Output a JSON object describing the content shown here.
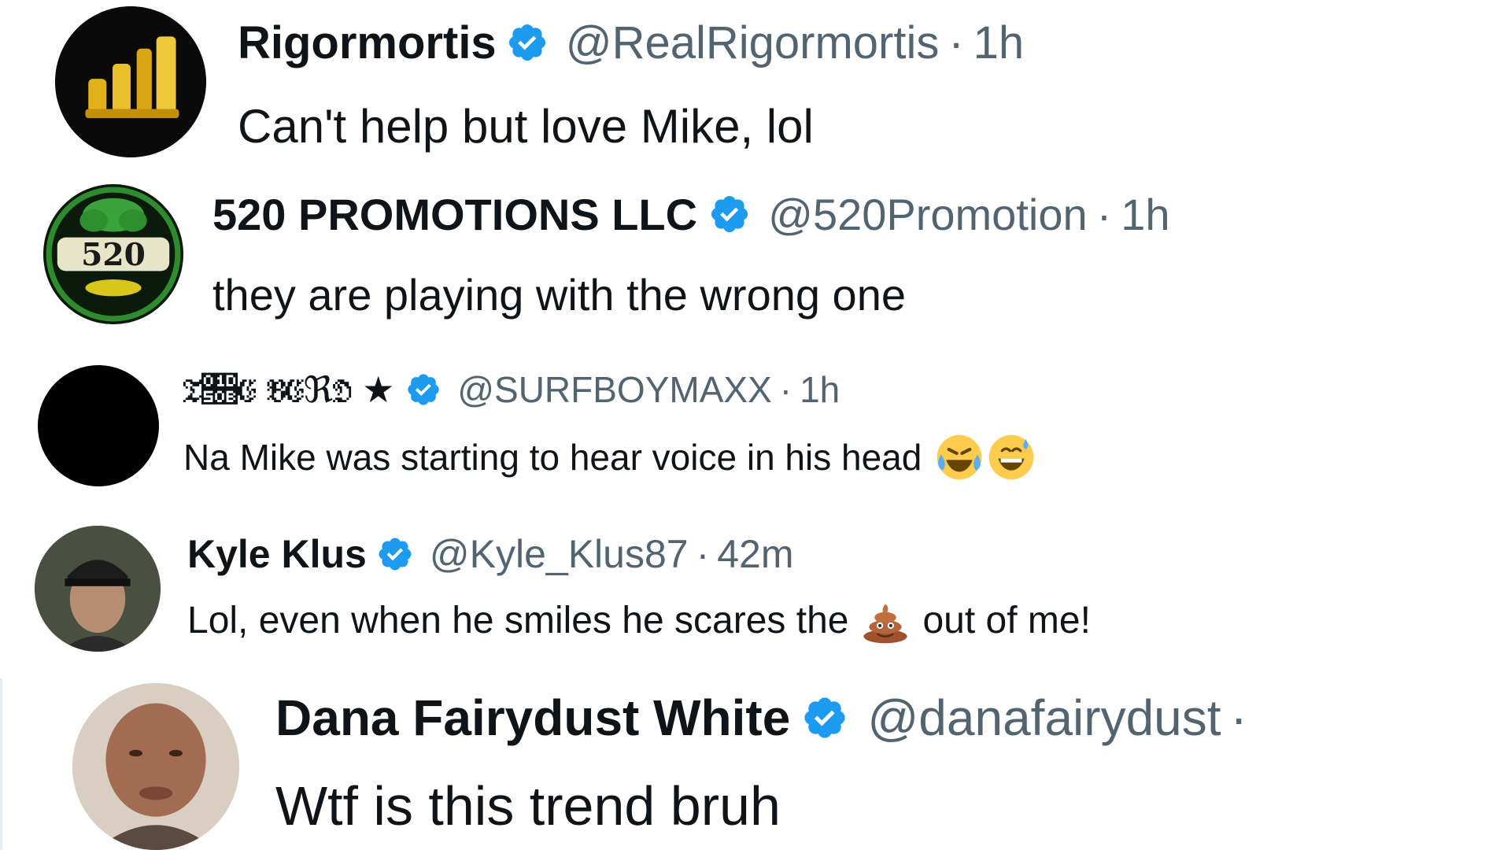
{
  "colors": {
    "verified_blue": "#1d9bf0",
    "secondary_text": "#536471",
    "primary_text": "#0f1419"
  },
  "replies": [
    {
      "display_name": "Rigormortis",
      "handle": "@RealRigormortis",
      "separator": "·",
      "time": "1h",
      "text": "Can't help but love Mike, lol",
      "avatar_icon": "gold-stacks-logo",
      "verified_icon": "verified-badge-icon"
    },
    {
      "display_name": "520 PROMOTIONS LLC",
      "handle": "@520Promotion",
      "separator": "·",
      "time": "1h",
      "text": "they are playing with the wrong one",
      "avatar_icon": "520-tree-logo",
      "avatar_text": "520",
      "verified_icon": "verified-badge-icon"
    },
    {
      "display_name": "𝔗𝔋𝔈 𝔅𝔈ℜ𝔇",
      "name_suffix": "★",
      "handle": "@SURFBOYMAXX",
      "separator": "·",
      "time": "1h",
      "text": "Na Mike was starting to hear voice in his head",
      "emojis": [
        "face-with-tears-of-joy-emoji",
        "grinning-sweat-emoji"
      ],
      "avatar_icon": "black-circle-avatar",
      "verified_icon": "verified-badge-icon"
    },
    {
      "display_name": "Kyle Klus",
      "handle": "@Kyle_Klus87",
      "separator": "·",
      "time": "42m",
      "text_before": "Lol, even when he smiles he scares the",
      "text_after": "out of me!",
      "emoji": "pile-of-poo-emoji",
      "avatar_icon": "man-with-cap-photo",
      "verified_icon": "verified-badge-icon"
    },
    {
      "display_name": "Dana Fairydust White",
      "handle": "@danafairydust",
      "separator": "·",
      "text": "Wtf is this trend bruh",
      "avatar_icon": "man-face-photo",
      "verified_icon": "verified-badge-icon"
    }
  ]
}
